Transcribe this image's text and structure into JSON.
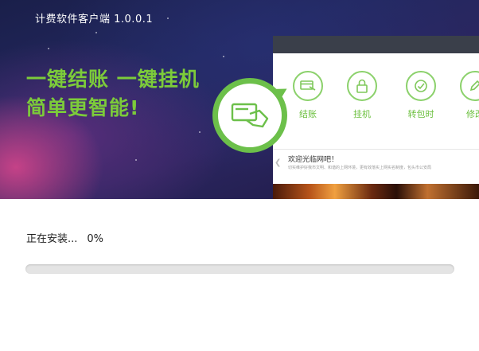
{
  "window": {
    "title": "计费软件客户端 1.0.0.1"
  },
  "banner": {
    "slogan_line1": "一键结账  一键挂机",
    "slogan_line2": "简单更智能!",
    "callout_icon": "card-payment-icon"
  },
  "client_preview": {
    "features": [
      {
        "label": "结账",
        "icon": "card-payment-icon"
      },
      {
        "label": "挂机",
        "icon": "lock-icon"
      },
      {
        "label": "转包时",
        "icon": "clock-icon"
      },
      {
        "label": "修改",
        "icon": "edit-icon"
      }
    ],
    "welcome_title": "欢迎光临网吧！",
    "welcome_subtitle": "切实维护好我市文明、和谐的上网环境，更有效落实上网实名制度，包头市公安局"
  },
  "install": {
    "status_text": "正在安装...",
    "percent_text": "0%",
    "progress": 0
  },
  "colors": {
    "accent": "#6cc04a",
    "slogan": "#7ccb3a"
  }
}
